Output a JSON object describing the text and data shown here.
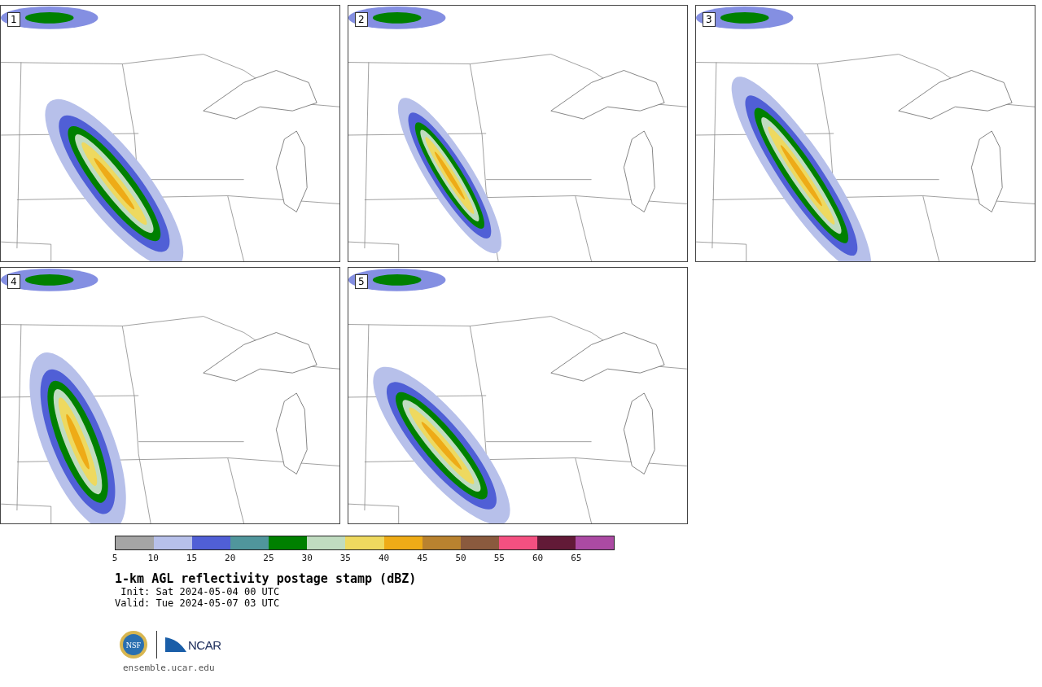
{
  "panels": [
    {
      "label": "1"
    },
    {
      "label": "2"
    },
    {
      "label": "3"
    },
    {
      "label": "4"
    },
    {
      "label": "5"
    }
  ],
  "colorbar": {
    "bins": [
      {
        "color": "#a5a5a5"
      },
      {
        "color": "#b7c0ea"
      },
      {
        "color": "#505fd6"
      },
      {
        "color": "#50969c"
      },
      {
        "color": "#008000"
      },
      {
        "color": "#c0dcc0"
      },
      {
        "color": "#eed95f"
      },
      {
        "color": "#eeab17"
      },
      {
        "color": "#b9822f"
      },
      {
        "color": "#8a5a3e"
      },
      {
        "color": "#f45081"
      },
      {
        "color": "#621a37"
      },
      {
        "color": "#ab4aa3"
      }
    ],
    "ticks": [
      "5",
      "10",
      "15",
      "20",
      "25",
      "30",
      "35",
      "40",
      "45",
      "50",
      "55",
      "60",
      "65"
    ]
  },
  "title": "1-km AGL reflectivity postage stamp (dBZ)",
  "init": " Init: Sat 2024-05-04 00 UTC",
  "valid": "Valid: Tue 2024-05-07 03 UTC",
  "logos": {
    "nsf": "NSF",
    "ncar": "NCAR"
  },
  "url": "ensemble.ucar.edu"
}
